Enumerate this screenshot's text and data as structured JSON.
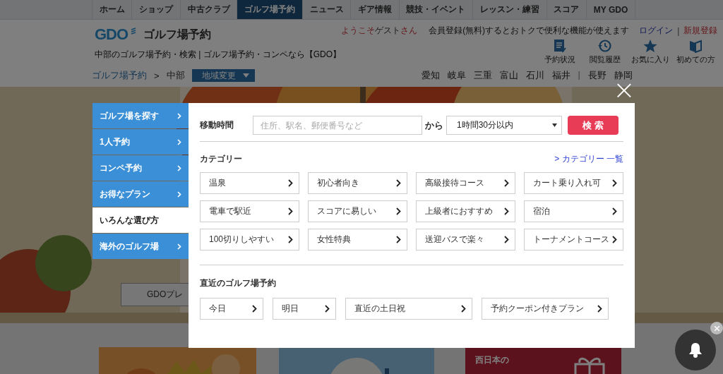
{
  "global_nav": [
    {
      "label": "ホーム",
      "selected": false
    },
    {
      "label": "ショップ",
      "selected": false
    },
    {
      "label": "中古クラブ",
      "selected": false
    },
    {
      "label": "ゴルフ場予約",
      "selected": true
    },
    {
      "label": "ニュース",
      "selected": false
    },
    {
      "label": "ギア情報",
      "selected": false
    },
    {
      "label": "競技・イベント",
      "selected": false
    },
    {
      "label": "レッスン・練習",
      "selected": false
    },
    {
      "label": "スコア",
      "selected": false
    },
    {
      "label": "MY GDO",
      "selected": false
    }
  ],
  "header": {
    "logo": "GDO",
    "site_title": "ゴルフ場予約",
    "tagline": "中部のゴルフ場予約・検索 | ゴルフ場予約・コンペなら【GDO】",
    "welcome": {
      "prefix": "ようこそ",
      "name": "ゲスト",
      "suffix": "さん"
    },
    "promo": "会員登録(無料)するとおトクで便利な機能が使えます",
    "login": "ログイン",
    "separator": "|",
    "register": "新規登録",
    "shortcuts": [
      {
        "kind": "list",
        "label": "予約状況"
      },
      {
        "kind": "history",
        "label": "閲覧履歴"
      },
      {
        "kind": "star",
        "label": "お気に入り"
      },
      {
        "kind": "book",
        "label": "初めての方"
      }
    ]
  },
  "breadcrumb": {
    "root": "ゴルフ場予約",
    "separator": ">",
    "current": "中部",
    "region_button": "地域変更"
  },
  "prefectures": [
    {
      "label": "愛知"
    },
    {
      "label": "岐阜"
    },
    {
      "label": "三重"
    },
    {
      "label": "富山"
    },
    {
      "label": "石川"
    },
    {
      "label": "福井"
    },
    {
      "kind": "divider",
      "label": "|"
    },
    {
      "label": "長野"
    },
    {
      "label": "静岡"
    }
  ],
  "hero": {
    "kind": "picture",
    "button": "GDOプレ"
  },
  "cards": [
    {
      "kind": "picture"
    },
    {
      "kind": "picture"
    },
    {
      "kind": "banner",
      "text": "西日本の"
    }
  ],
  "modal": {
    "close": "×",
    "menu": [
      {
        "label": "ゴルフ場を探す",
        "selected": false
      },
      {
        "label": "1人予約",
        "selected": false
      },
      {
        "label": "コンペ予約",
        "selected": false
      },
      {
        "label": "お得なプラン",
        "selected": false
      },
      {
        "label": "いろんな選び方",
        "selected": true
      },
      {
        "label": "海外のゴルフ場",
        "selected": false
      }
    ],
    "search": {
      "label": "移動時間",
      "placeholder": "住所、駅名、郵便番号など",
      "from": "から",
      "time": "1時間30分以内",
      "button": "検 索"
    },
    "category_title": "カテゴリー",
    "category_link": "> カテゴリー 一覧",
    "categories": [
      "温泉",
      "初心者向き",
      "高級接待コース",
      "カート乗り入れ可",
      "電車で駅近",
      "スコアに易しい",
      "上級者におすすめ",
      "宿泊",
      "100切りしやすい",
      "女性特典",
      "送迎バスで楽々",
      "トーナメントコース"
    ],
    "recent_title": "直近のゴルフ場予約",
    "recent": [
      "今日",
      "明日",
      "直近の土日祝",
      "予約クーポン付きプラン"
    ]
  }
}
